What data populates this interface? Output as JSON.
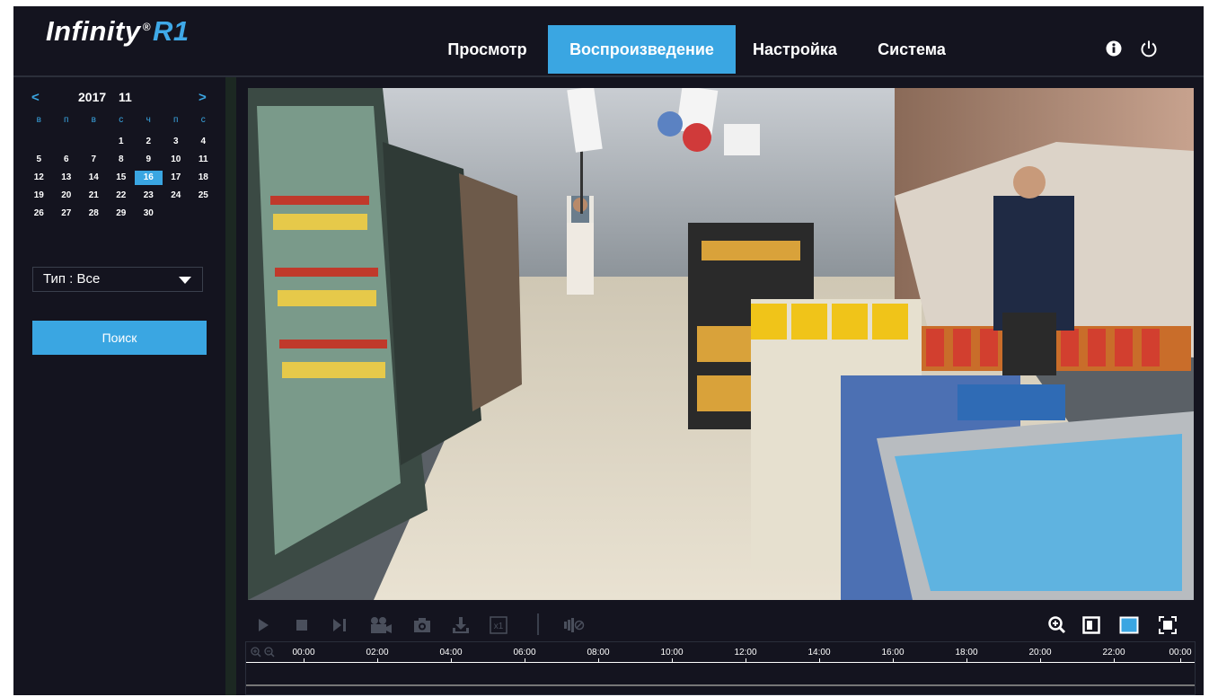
{
  "header": {
    "logo_text": "Infinity",
    "logo_reg": "®",
    "logo_model": "R1",
    "nav": [
      {
        "label": "Просмотр",
        "active": false
      },
      {
        "label": "Воспроизведение",
        "active": true
      },
      {
        "label": "Настройка",
        "active": false
      },
      {
        "label": "Система",
        "active": false
      }
    ],
    "icons": [
      "info-icon",
      "power-icon"
    ]
  },
  "calendar": {
    "prev": "<",
    "next": ">",
    "year": "2017",
    "month": "11",
    "weekdays": [
      "в",
      "п",
      "в",
      "с",
      "ч",
      "п",
      "с"
    ],
    "weeks": [
      [
        "",
        "",
        "",
        "1",
        "2",
        "3",
        "4"
      ],
      [
        "5",
        "6",
        "7",
        "8",
        "9",
        "10",
        "11"
      ],
      [
        "12",
        "13",
        "14",
        "15",
        "16",
        "17",
        "18"
      ],
      [
        "19",
        "20",
        "21",
        "22",
        "23",
        "24",
        "25"
      ],
      [
        "26",
        "27",
        "28",
        "29",
        "30",
        "",
        ""
      ]
    ],
    "selected": "16"
  },
  "filter": {
    "type_label": "Тип : Все"
  },
  "search": {
    "label": "Поиск"
  },
  "playback_controls": {
    "left": [
      "play-icon",
      "stop-icon",
      "next-frame-icon",
      "record-clip-icon",
      "snapshot-icon",
      "download-icon",
      "speed-x1-icon",
      "audio-mute-icon"
    ],
    "speed_label": "x1",
    "right": [
      "zoom-in-icon",
      "single-view-icon",
      "layout-view-icon",
      "fullscreen-icon"
    ]
  },
  "timeline": {
    "labels": [
      "00:00",
      "02:00",
      "04:00",
      "06:00",
      "08:00",
      "10:00",
      "12:00",
      "14:00",
      "16:00",
      "18:00",
      "20:00",
      "22:00",
      "00:00"
    ],
    "zoom_icons": [
      "timeline-zoom-in-icon",
      "timeline-zoom-out-icon"
    ]
  },
  "colors": {
    "accent": "#3aa6e2",
    "background": "#14141f"
  }
}
